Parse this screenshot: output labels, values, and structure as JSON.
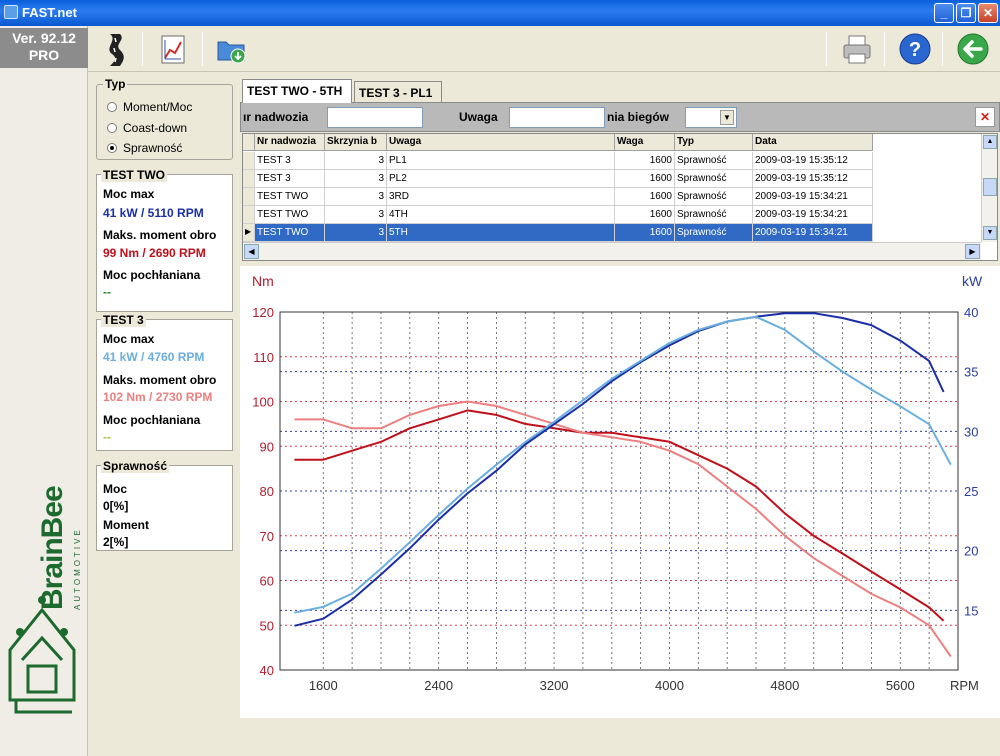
{
  "window": {
    "title": "FAST.net"
  },
  "left": {
    "version_line1": "Ver. 92.12",
    "version_line2": "PRO",
    "logo_name": "BrainBee",
    "logo_sub": "AUTOMOTIVE"
  },
  "typ": {
    "title": "Typ",
    "options": [
      "Moment/Moc",
      "Coast-down",
      "Sprawność"
    ],
    "selected": "Sprawność"
  },
  "test_two": {
    "title": "TEST TWO",
    "moc_max_label": "Moc max",
    "moc_max_value": "41 kW / 5110 RPM",
    "moment_label": "Maks. moment obro",
    "moment_value": "99 Nm / 2690 RPM",
    "pochl_label": "Moc pochłaniana",
    "pochl_value": "--"
  },
  "test_3": {
    "title": "TEST 3",
    "moc_max_label": "Moc max",
    "moc_max_value": "41 kW / 4760 RPM",
    "moment_label": "Maks. moment obro",
    "moment_value": "102 Nm / 2730 RPM",
    "pochl_label": "Moc pochłaniana",
    "pochl_value": "--"
  },
  "sprawnosc": {
    "title": "Sprawność",
    "moc_label": "Moc",
    "moc_value": "0[%]",
    "moment_label": "Moment",
    "moment_value": "2[%]"
  },
  "tabs": [
    "TEST TWO - 5TH",
    "TEST 3 - PL1"
  ],
  "filter": {
    "nadwozia_label": "ır nadwozia",
    "uwaga_label": "Uwaga",
    "biegow_label": "nia biegów"
  },
  "grid": {
    "headers": [
      "Nr nadwozia",
      "Skrzynia b",
      "Uwaga",
      "Waga",
      "Typ",
      "Data"
    ],
    "rows": [
      [
        "TEST 3",
        "3",
        "PL1",
        "1600",
        "Sprawność",
        "2009-03-19 15:35:12"
      ],
      [
        "TEST 3",
        "3",
        "PL2",
        "1600",
        "Sprawność",
        "2009-03-19 15:35:12"
      ],
      [
        "TEST TWO",
        "3",
        "3RD",
        "1600",
        "Sprawność",
        "2009-03-19 15:34:21"
      ],
      [
        "TEST TWO",
        "3",
        "4TH",
        "1600",
        "Sprawność",
        "2009-03-19 15:34:21"
      ],
      [
        "TEST TWO",
        "3",
        "5TH",
        "1600",
        "Sprawność",
        "2009-03-19 15:34:21"
      ]
    ],
    "selected_row": 4
  },
  "colors": {
    "test_two_power": "#1a2ea8",
    "test_two_torque": "#c0101a",
    "test_3_power": "#6aaee0",
    "test_3_torque": "#ec8080"
  },
  "chart_data": {
    "type": "line",
    "ylabel": "Nm",
    "y2label": "kW",
    "xlabel": "RPM",
    "xticks": [
      1600,
      2400,
      3200,
      4000,
      4800,
      5600
    ],
    "yticks": [
      40,
      50,
      60,
      70,
      80,
      90,
      100,
      110,
      120
    ],
    "y2ticks": [
      15,
      20,
      25,
      30,
      35,
      40
    ],
    "xlim": [
      1300,
      6000
    ],
    "ylim": [
      40,
      120
    ],
    "y2lim": [
      10,
      40
    ],
    "grid": true,
    "series": [
      {
        "axis": "y",
        "color": "#c0101a",
        "x": [
          1400,
          1600,
          1800,
          2000,
          2200,
          2400,
          2600,
          2800,
          3000,
          3200,
          3400,
          3600,
          3800,
          4000,
          4200,
          4400,
          4600,
          4800,
          5000,
          5200,
          5400,
          5600,
          5800,
          5900
        ],
        "y": [
          87,
          87,
          89,
          91,
          94,
          96,
          98,
          97,
          95,
          94,
          93,
          93,
          92,
          91,
          88,
          85,
          81,
          75,
          70,
          66,
          62,
          58,
          54,
          51
        ]
      },
      {
        "axis": "y",
        "color": "#ec8080",
        "x": [
          1400,
          1600,
          1800,
          2000,
          2200,
          2400,
          2600,
          2800,
          3000,
          3200,
          3400,
          3600,
          3800,
          4000,
          4200,
          4400,
          4600,
          4800,
          5000,
          5200,
          5400,
          5600,
          5800,
          5950
        ],
        "y": [
          96,
          96,
          94,
          94,
          97,
          99,
          100,
          99,
          97,
          95,
          93,
          92,
          91,
          89,
          86,
          81,
          76,
          70,
          65,
          61,
          57,
          54,
          50,
          43
        ]
      },
      {
        "axis": "y2",
        "color": "#1a2ea8",
        "x": [
          1400,
          1600,
          1800,
          2000,
          2200,
          2400,
          2600,
          2800,
          3000,
          3200,
          3400,
          3600,
          3800,
          4000,
          4200,
          4400,
          4600,
          4800,
          5000,
          5200,
          5400,
          5600,
          5800,
          5900
        ],
        "y": [
          13.7,
          14.3,
          15.9,
          18.0,
          20.2,
          22.6,
          24.8,
          26.7,
          28.9,
          30.6,
          32.3,
          34.2,
          35.8,
          37.2,
          38.4,
          39.2,
          39.6,
          39.9,
          39.9,
          39.5,
          38.9,
          37.6,
          35.9,
          33.3
        ]
      },
      {
        "axis": "y2",
        "color": "#6aaee0",
        "x": [
          1400,
          1600,
          1800,
          2000,
          2200,
          2400,
          2600,
          2800,
          3000,
          3200,
          3400,
          3600,
          3800,
          4000,
          4200,
          4400,
          4600,
          4800,
          5000,
          5200,
          5400,
          5600,
          5800,
          5950
        ],
        "y": [
          14.8,
          15.3,
          16.4,
          18.5,
          20.7,
          23.0,
          25.2,
          27.2,
          29.1,
          30.8,
          32.6,
          34.4,
          35.9,
          37.4,
          38.5,
          39.2,
          39.6,
          38.5,
          36.7,
          35.0,
          33.5,
          32.1,
          30.6,
          27.2
        ]
      }
    ]
  }
}
